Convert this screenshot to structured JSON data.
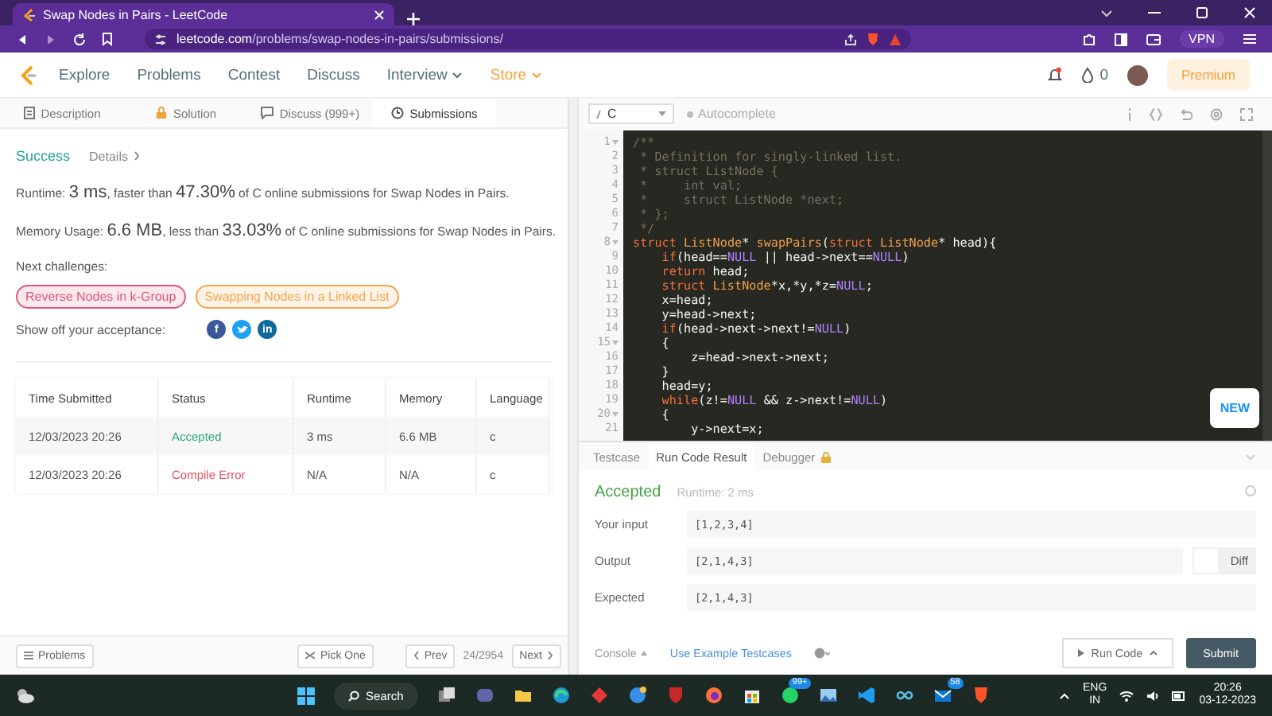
{
  "browser": {
    "tab_title": "Swap Nodes in Pairs - LeetCode",
    "url_host": "leetcode.com",
    "url_path": "/problems/swap-nodes-in-pairs/submissions/",
    "vpn": "VPN"
  },
  "nav": {
    "items": [
      {
        "label": "Explore",
        "kind": "link"
      },
      {
        "label": "Problems",
        "kind": "link"
      },
      {
        "label": "Contest",
        "kind": "link"
      },
      {
        "label": "Discuss",
        "kind": "link"
      },
      {
        "label": "Interview",
        "kind": "menu"
      },
      {
        "label": "Store",
        "kind": "store"
      }
    ],
    "points": "0",
    "premium": "Premium"
  },
  "left_tabs": [
    {
      "label": "Description",
      "kind": "doc",
      "selected": false
    },
    {
      "label": "Solution",
      "kind": "lock",
      "selected": false
    },
    {
      "label": "Discuss (999+)",
      "kind": "chat",
      "selected": false
    },
    {
      "label": "Submissions",
      "kind": "clock",
      "selected": true
    }
  ],
  "result": {
    "status": "Success",
    "details": "Details",
    "runtime": "Runtime: **3 ms**, faster than **47.30%** of C online submissions for Swap Nodes in Pairs.",
    "memory": "Memory Usage: **6.6 MB**, less than **33.03%** of C online submissions for Swap Nodes in Pairs.",
    "next_label": "Next challenges:",
    "challenges": [
      {
        "label": "Reverse Nodes in k-Group",
        "color": "#e0577a"
      },
      {
        "label": "Swapping Nodes in a Linked List",
        "color": "#f5a54a"
      }
    ],
    "share_label": "Show off your acceptance:",
    "share": [
      {
        "kind": "letter",
        "glyph": "f",
        "color": "#3b5998"
      },
      {
        "kind": "bird",
        "color": "#1da1f2"
      },
      {
        "kind": "letter",
        "glyph": "in",
        "color": "#0e6a9c"
      }
    ]
  },
  "submissions": {
    "columns": [
      "Time Submitted",
      "Status",
      "Runtime",
      "Memory",
      "Language"
    ],
    "rows": [
      {
        "time": "12/03/2023 20:26",
        "status": "Accepted",
        "kind": "accepted",
        "runtime": "3 ms",
        "memory": "6.6 MB",
        "language": "c"
      },
      {
        "time": "12/03/2023 20:26",
        "status": "Compile Error",
        "kind": "error",
        "runtime": "N/A",
        "memory": "N/A",
        "language": "c"
      }
    ]
  },
  "left_footer": {
    "problems": "Problems",
    "pick": "Pick One",
    "prev": "Prev",
    "page": "24/2954",
    "next": "Next"
  },
  "editor": {
    "language": "C",
    "autocomplete": "Autocomplete",
    "new_badge": "NEW",
    "lines": [
      {
        "n": "1",
        "fold": true,
        "tokens": [
          {
            "text": "/**",
            "kind": "comment"
          }
        ]
      },
      {
        "n": "2",
        "fold": false,
        "tokens": [
          {
            "text": " * Definition for singly-linked list.",
            "kind": "comment"
          }
        ]
      },
      {
        "n": "3",
        "fold": false,
        "tokens": [
          {
            "text": " * struct ListNode {",
            "kind": "comment"
          }
        ]
      },
      {
        "n": "4",
        "fold": false,
        "tokens": [
          {
            "text": " *     int val;",
            "kind": "comment"
          }
        ]
      },
      {
        "n": "5",
        "fold": false,
        "tokens": [
          {
            "text": " *     struct ListNode *next;",
            "kind": "comment"
          }
        ]
      },
      {
        "n": "6",
        "fold": false,
        "tokens": [
          {
            "text": " * };",
            "kind": "comment"
          }
        ]
      },
      {
        "n": "7",
        "fold": false,
        "tokens": [
          {
            "text": " */",
            "kind": "comment"
          }
        ]
      },
      {
        "n": "8",
        "fold": true,
        "tokens": [
          {
            "text": "struct",
            "kind": "keyword"
          },
          {
            "text": " ListNode",
            "kind": "type"
          },
          {
            "text": "* ",
            "kind": "plain"
          },
          {
            "text": "swapPairs",
            "kind": "function"
          },
          {
            "text": "(",
            "kind": "plain"
          },
          {
            "text": "struct",
            "kind": "keyword"
          },
          {
            "text": " ListNode",
            "kind": "type"
          },
          {
            "text": "* head){",
            "kind": "plain"
          }
        ]
      },
      {
        "n": "9",
        "fold": false,
        "tokens": [
          {
            "text": "    if",
            "kind": "keyword"
          },
          {
            "text": "(head==",
            "kind": "plain"
          },
          {
            "text": "NULL",
            "kind": "constant"
          },
          {
            "text": " || head->next==",
            "kind": "plain"
          },
          {
            "text": "NULL",
            "kind": "constant"
          },
          {
            "text": ")",
            "kind": "plain"
          }
        ]
      },
      {
        "n": "10",
        "fold": false,
        "tokens": [
          {
            "text": "    return",
            "kind": "keyword"
          },
          {
            "text": " head;",
            "kind": "plain"
          }
        ]
      },
      {
        "n": "11",
        "fold": false,
        "tokens": [
          {
            "text": "    struct",
            "kind": "keyword"
          },
          {
            "text": " ListNode",
            "kind": "type"
          },
          {
            "text": "*x,*y,*z=",
            "kind": "plain"
          },
          {
            "text": "NULL",
            "kind": "constant"
          },
          {
            "text": ";",
            "kind": "plain"
          }
        ]
      },
      {
        "n": "12",
        "fold": false,
        "tokens": [
          {
            "text": "    x=head;",
            "kind": "plain"
          }
        ]
      },
      {
        "n": "13",
        "fold": false,
        "tokens": [
          {
            "text": "    y=head->next;",
            "kind": "plain"
          }
        ]
      },
      {
        "n": "14",
        "fold": false,
        "tokens": [
          {
            "text": "    if",
            "kind": "keyword"
          },
          {
            "text": "(head->next->next!=",
            "kind": "plain"
          },
          {
            "text": "NULL",
            "kind": "constant"
          },
          {
            "text": ")",
            "kind": "plain"
          }
        ]
      },
      {
        "n": "15",
        "fold": true,
        "tokens": [
          {
            "text": "    {",
            "kind": "plain"
          }
        ]
      },
      {
        "n": "16",
        "fold": false,
        "tokens": [
          {
            "text": "        z=head->next->next;",
            "kind": "plain"
          }
        ]
      },
      {
        "n": "17",
        "fold": false,
        "tokens": [
          {
            "text": "    }",
            "kind": "plain"
          }
        ]
      },
      {
        "n": "18",
        "fold": false,
        "tokens": [
          {
            "text": "    head=y;",
            "kind": "plain"
          }
        ]
      },
      {
        "n": "19",
        "fold": false,
        "tokens": [
          {
            "text": "    while",
            "kind": "keyword"
          },
          {
            "text": "(z!=",
            "kind": "plain"
          },
          {
            "text": "NULL",
            "kind": "constant"
          },
          {
            "text": " && z->next!=",
            "kind": "plain"
          },
          {
            "text": "NULL",
            "kind": "constant"
          },
          {
            "text": ")",
            "kind": "plain"
          }
        ]
      },
      {
        "n": "20",
        "fold": true,
        "tokens": [
          {
            "text": "    {",
            "kind": "plain"
          }
        ]
      },
      {
        "n": "21",
        "fold": false,
        "tokens": [
          {
            "text": "        y->next=x;",
            "kind": "plain"
          }
        ]
      }
    ]
  },
  "console": {
    "tabs": [
      {
        "label": "Testcase",
        "selected": false,
        "locked": false
      },
      {
        "label": "Run Code Result",
        "selected": true,
        "locked": false
      },
      {
        "label": "Debugger",
        "selected": false,
        "locked": true
      }
    ],
    "verdict": "Accepted",
    "runtime": "Runtime: 2 ms",
    "fields": [
      {
        "label": "Your input",
        "value": "[1,2,3,4]"
      },
      {
        "label": "Output",
        "value": "[2,1,4,3]",
        "diff": "Diff"
      },
      {
        "label": "Expected",
        "value": "[2,1,4,3]"
      }
    ],
    "console_label": "Console",
    "example": "Use Example Testcases",
    "run": "Run Code",
    "submit": "Submit"
  },
  "taskbar": {
    "search": "Search",
    "apps": [
      {
        "kind": "taskview"
      },
      {
        "kind": "chat"
      },
      {
        "kind": "folder"
      },
      {
        "kind": "edge"
      },
      {
        "kind": "diamond"
      },
      {
        "kind": "globe"
      },
      {
        "kind": "shield"
      },
      {
        "kind": "firefox"
      },
      {
        "kind": "store"
      },
      {
        "kind": "whatsapp",
        "badge": "99+"
      },
      {
        "kind": "photos"
      },
      {
        "kind": "vscode"
      },
      {
        "kind": "infinity"
      },
      {
        "kind": "mail",
        "badge": "58"
      },
      {
        "kind": "brave"
      }
    ],
    "lang": "ENG",
    "region": "IN",
    "time": "20:26",
    "date": "03-12-2023"
  }
}
